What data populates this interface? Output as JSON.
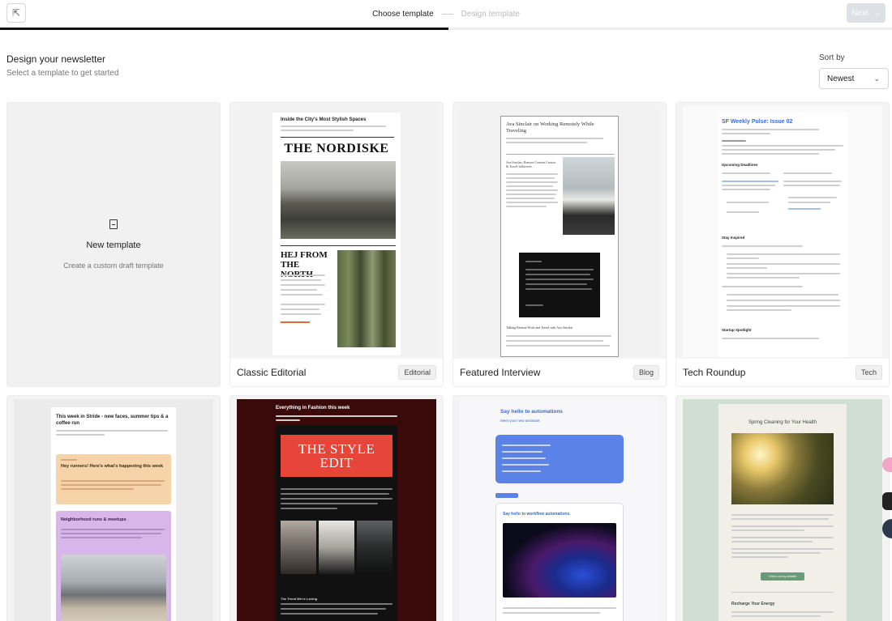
{
  "header": {
    "steps": [
      "Choose template",
      "Design template"
    ],
    "next_label": "Next"
  },
  "page": {
    "title": "Design your newsletter",
    "subtitle": "Select a template to get started"
  },
  "sort": {
    "label": "Sort by",
    "value": "Newest"
  },
  "new_template": {
    "title": "New template",
    "subtitle": "Create a custom draft template"
  },
  "templates": [
    {
      "name": "Classic Editorial",
      "tag": "Editorial",
      "preview": {
        "headline": "Inside the City's Most Stylish Spaces",
        "masthead": "THE NORDISKE",
        "section": "HEJ FROM THE NORTH"
      }
    },
    {
      "name": "Featured Interview",
      "tag": "Blog",
      "preview": {
        "headline": "Ava Sinclair on Working Remotely While Traveling",
        "subhead": "Ava Sinclair: Remote Content Creator & Travel Influencer",
        "footer_head": "Talking Remote Work and Travel with Ava Sinclair"
      }
    },
    {
      "name": "Tech Roundup",
      "tag": "Tech",
      "preview": {
        "headline": "SF Weekly Pulse: Issue 02",
        "section1": "Upcoming Deadlines",
        "section2": "Stay Inspired",
        "section3": "Startup Spotlight"
      }
    },
    {
      "name": "",
      "tag": "",
      "preview": {
        "headline": "This week in Stride - new faces, summer tips & a coffee run",
        "box1": "Hey runners! Here's what's happening this week",
        "box2": "Neighborhood runs & meetups"
      }
    },
    {
      "name": "",
      "tag": "",
      "preview": {
        "headline": "Everything in Fashion this week",
        "masthead": "THE STYLE EDIT",
        "footer_head": "The Trend We're Loving"
      }
    },
    {
      "name": "",
      "tag": "",
      "preview": {
        "headline": "Say hello to automations",
        "subhead": "Meet your new assistant",
        "section": "Say hello to workflow automations."
      }
    },
    {
      "name": "",
      "tag": "",
      "preview": {
        "headline": "Spring Cleaning for Your Health",
        "button": "Check out my website",
        "section": "Recharge Your Energy"
      }
    }
  ],
  "colors": {
    "accent": "#111111",
    "link_blue": "#3a6bd1",
    "fashion_bg": "#3a0a0a",
    "fashion_red": "#e8453a",
    "stride_peach": "#f6d3a8",
    "stride_lilac": "#d9b6ea",
    "health_green": "#cfe0d3"
  }
}
